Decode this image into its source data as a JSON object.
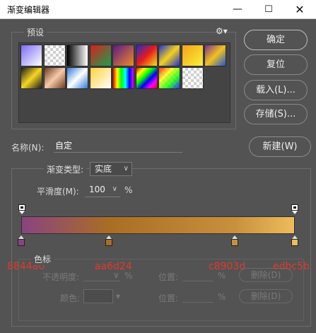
{
  "window": {
    "title": "渐变编辑器",
    "minimize_icon": "minimize-icon",
    "maximize_icon": "maximize-icon",
    "close_icon": "close-icon"
  },
  "presets": {
    "label": "预设",
    "menu_icon": "gear-icon",
    "swatches": [
      {
        "bg": "linear-gradient(135deg,#7b6cf5,#ffffff)"
      },
      {
        "bg": "checker-white"
      },
      {
        "bg": "linear-gradient(90deg,#000,#fff)"
      },
      {
        "bg": "linear-gradient(135deg,#d91f1f,#16a34a)"
      },
      {
        "bg": "linear-gradient(135deg,#5a1a8c,#f08a24)"
      },
      {
        "bg": "linear-gradient(135deg,#1b2ecf,#e81a1a,#f5e11a)"
      },
      {
        "bg": "linear-gradient(135deg,#1f2fd8,#f4d21a,#1f2fd8)"
      },
      {
        "bg": "linear-gradient(135deg,#f4a21a,#f8f238)"
      },
      {
        "bg": "linear-gradient(135deg,#7a2f9c,#f2c21a,#1f54d8)"
      },
      {
        "bg": "linear-gradient(135deg,#1b1b1b,#f6d623,#1b1b1b)"
      },
      {
        "bg": "linear-gradient(135deg,#6b3a24,#f7c9a8,#6b3a24)"
      },
      {
        "bg": "linear-gradient(135deg,#2d7ad6,#ffffff,#2d7ad6)"
      },
      {
        "bg": "linear-gradient(135deg,#ffd23a,#ffffff)"
      },
      {
        "bg": "linear-gradient(90deg,#ff0000,#ffff00,#00ff00,#00ffff,#0000ff,#ff00ff)"
      },
      {
        "bg": "linear-gradient(135deg,#ff0000,#ffff00,#00ff00,#0000ff,#ff00ff,#ff0000)"
      },
      {
        "bg": "checker-rainbow"
      },
      {
        "bg": "checker-white"
      }
    ]
  },
  "buttons": {
    "ok": "确定",
    "reset": "复位",
    "load": "载入(L)...",
    "save": "存储(S)...",
    "new": "新建(W)"
  },
  "name": {
    "label": "名称(N):",
    "value": "自定"
  },
  "gradient_type": {
    "label": "渐变类型:",
    "value": "实底"
  },
  "smoothness": {
    "label": "平滑度(M):",
    "value": "100",
    "unit": "%"
  },
  "gradient": {
    "colors": [
      "#884480",
      "#aa6d24",
      "#c8903d",
      "#edbc5b"
    ],
    "bar_colors": [
      "#884480",
      "#aa6d24",
      "#c8903d",
      "#edbc5b"
    ],
    "stops": [
      0,
      0.32,
      0.78,
      1
    ]
  },
  "annotations": {
    "hex_labels": [
      "884480",
      "aa6d24",
      "c8903d",
      "edbc5b"
    ]
  },
  "color_stops": {
    "label": "色标",
    "opacity_label": "不透明度:",
    "percent": "%",
    "position_label": "位置:",
    "delete": "删除(D)",
    "color_label": "颜色:"
  }
}
